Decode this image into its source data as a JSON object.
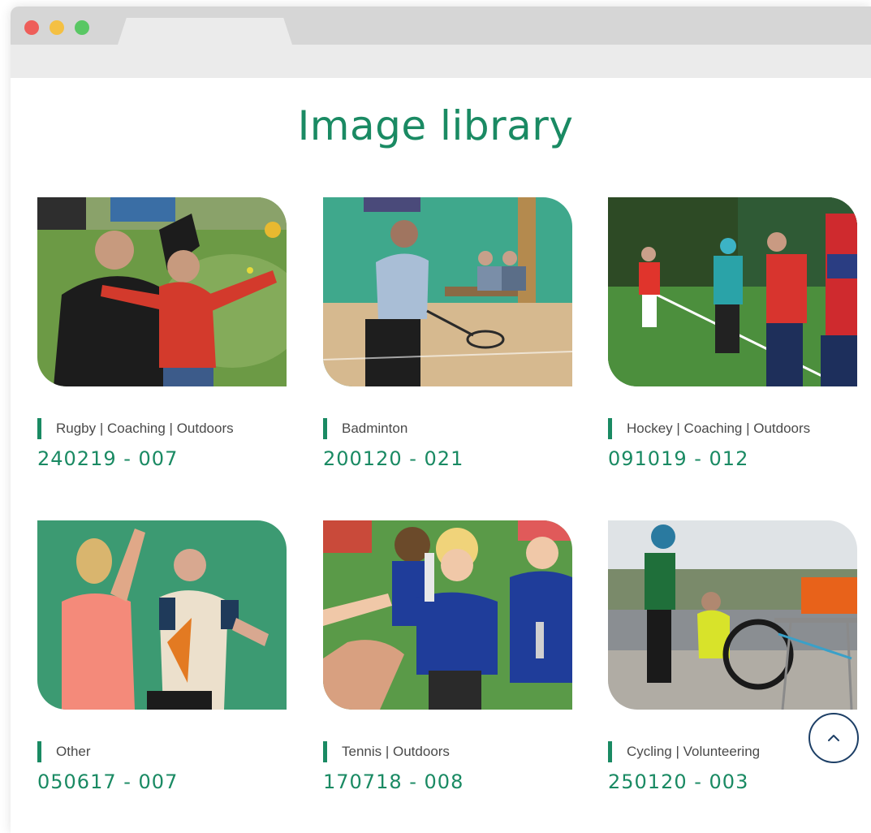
{
  "page": {
    "title": "Image library"
  },
  "colors": {
    "accent": "#1a8a63",
    "scroll_button_border": "#1d3f66"
  },
  "images": [
    {
      "tags": "Rugby | Coaching | Outdoors",
      "code": "240219 - 007"
    },
    {
      "tags": "Badminton",
      "code": "200120 - 021"
    },
    {
      "tags": "Hockey | Coaching | Outdoors",
      "code": "091019 - 012"
    },
    {
      "tags": "Other",
      "code": "050617 - 007"
    },
    {
      "tags": "Tennis | Outdoors",
      "code": "170718 - 008"
    },
    {
      "tags": "Cycling | Volunteering",
      "code": "250120 - 003"
    }
  ],
  "icons": {
    "scroll_top": "chevron-up-icon"
  }
}
